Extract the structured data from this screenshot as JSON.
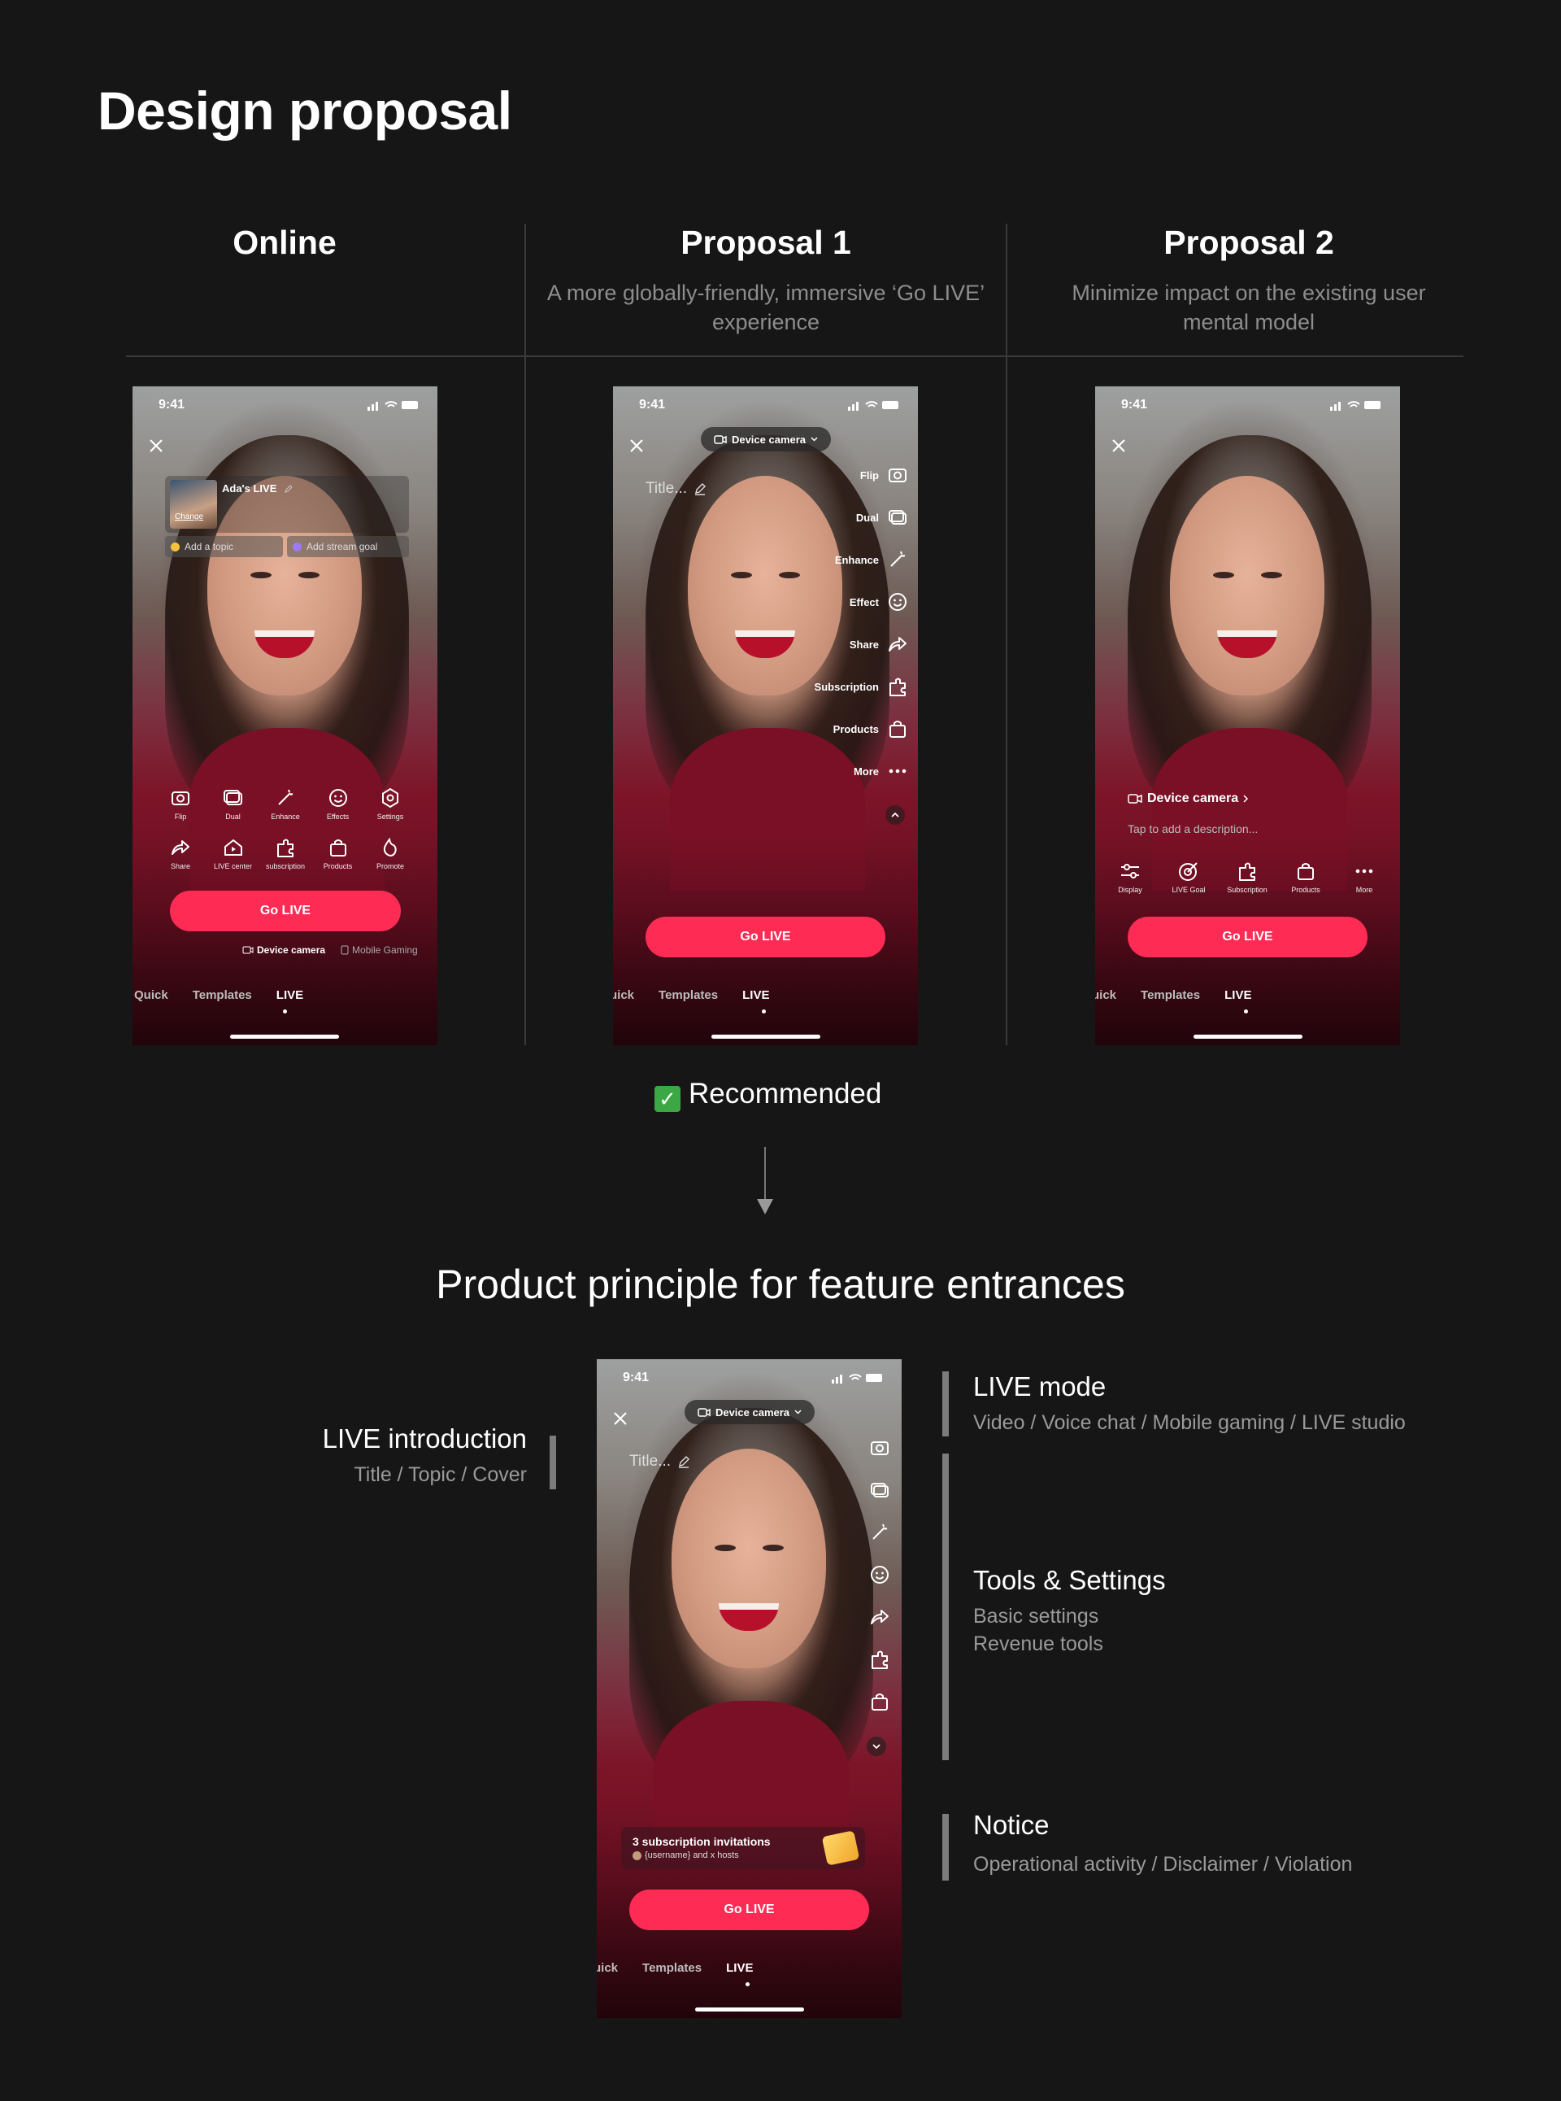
{
  "page": {
    "title": "Design proposal"
  },
  "columns": [
    {
      "title": "Online",
      "subtitle": ""
    },
    {
      "title": "Proposal 1",
      "subtitle": "A more globally-friendly, immersive ‘Go LIVE’ experience"
    },
    {
      "title": "Proposal 2",
      "subtitle": "Minimize impact on the existing user mental model"
    }
  ],
  "phone_common": {
    "time": "9:41",
    "go_live": "Go LIVE",
    "tab_quick": "Quick",
    "tab_quick_cut": "uick",
    "tab_templates": "Templates",
    "tab_live": "LIVE"
  },
  "online": {
    "live_title": "Ada's LIVE",
    "change": "Change",
    "add_topic": "Add a topic",
    "add_goal": "Add stream goal",
    "tools_row1": [
      "Flip",
      "Dual",
      "Enhance",
      "Effects",
      "Settings"
    ],
    "tools_row2": [
      "Share",
      "LIVE center",
      "subscription",
      "Products",
      "Promote"
    ],
    "mode_device": "Device camera",
    "mode_gaming": "Mobile Gaming"
  },
  "proposal1": {
    "camera_pill": "Device camera",
    "title_placeholder": "Title...",
    "side_tools": [
      "Flip",
      "Dual",
      "Enhance",
      "Effect",
      "Share",
      "Subscription",
      "Products",
      "More"
    ]
  },
  "proposal2": {
    "device_camera": "Device camera",
    "description_placeholder": "Tap to add a description...",
    "tools": [
      "Display",
      "LIVE Goal",
      "Subscription",
      "Products",
      "More"
    ]
  },
  "recommended": "Recommended",
  "principle": {
    "title": "Product principle for feature entrances",
    "notice_card_title": "3 subscription invitations",
    "notice_card_sub": "{username} and x hosts",
    "labels": {
      "intro_title": "LIVE introduction",
      "intro_sub": "Title / Topic / Cover",
      "mode_title": "LIVE mode",
      "mode_sub": "Video / Voice chat / Mobile gaming / LIVE studio",
      "tools_title": "Tools & Settings",
      "tools_sub1": "Basic settings",
      "tools_sub2": "Revenue tools",
      "notice_title": "Notice",
      "notice_sub": "Operational activity / Disclaimer / Violation"
    }
  }
}
